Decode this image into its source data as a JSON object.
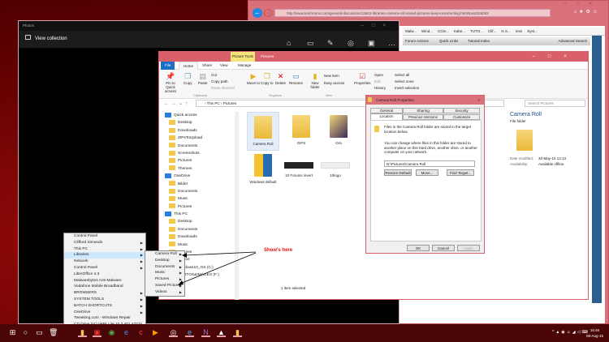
{
  "browser": {
    "url": "http://www.tenforums.com/general-discussion/13943-libraries-camera-roll-saved-pictures-keep-resurrecting.html#post326092",
    "bookmarks": [
      "Malw...",
      "Wind...",
      "CCle...",
      "Kabe...",
      "TUTO...",
      "Clif...",
      "Is S...",
      "msn",
      "Syst..."
    ],
    "forum_bar": {
      "forum_actions": "Forum Actions",
      "quick_links": "Quick Links",
      "tutorial_index": "Tutorial Index",
      "advanced_search": "Advanced Search"
    }
  },
  "photos": {
    "app_title": "Photos",
    "view_collection": "View collection"
  },
  "explorer": {
    "ribbon_context": "Picture Tools",
    "title": "Pictures",
    "tabs": [
      "File",
      "Home",
      "Share",
      "View",
      "Manage"
    ],
    "clipboard": {
      "pin": "Pin to Quick access",
      "copy": "Copy",
      "paste": "Paste",
      "cut": "Cut",
      "copy_path": "Copy path",
      "paste_shortcut": "Paste shortcut",
      "group": "Clipboard"
    },
    "organize": {
      "move_to": "Move to",
      "copy_to": "Copy to",
      "delete": "Delete",
      "rename": "Rename",
      "group": "Organize"
    },
    "new": {
      "new_folder": "New folder",
      "new_item": "New item",
      "easy_access": "Easy access",
      "group": "New"
    },
    "open": {
      "properties": "Properties",
      "open": "Open",
      "edit": "Edit",
      "history": "History",
      "group": "Open"
    },
    "select": {
      "select_all": "Select all",
      "select_none": "Select none",
      "invert": "Invert selection",
      "group": "Select"
    },
    "breadcrumb": [
      "This PC",
      "Pictures"
    ],
    "search_placeholder": "Search Pictures",
    "nav": [
      {
        "label": "Quick access",
        "top": true
      },
      {
        "label": "Desktop"
      },
      {
        "label": "Downloads"
      },
      {
        "label": "ZIPsToUpload"
      },
      {
        "label": "Documents"
      },
      {
        "label": "Screenshots"
      },
      {
        "label": "Pictures"
      },
      {
        "label": "Themes"
      },
      {
        "label": "OneDrive",
        "top": true
      },
      {
        "label": "Bilder"
      },
      {
        "label": "Documents"
      },
      {
        "label": "Music"
      },
      {
        "label": "Pictures"
      },
      {
        "label": "This PC",
        "top": true
      },
      {
        "label": "Desktop"
      },
      {
        "label": "Documents"
      },
      {
        "label": "Downloads"
      },
      {
        "label": "Music"
      },
      {
        "label": "Pictures"
      },
      {
        "label": "Videos"
      },
      {
        "label": "Windows10_OS (C:)"
      },
      {
        "label": "PHOTOS&IMAGES (F:)"
      }
    ],
    "items": [
      "Camera Roll",
      "GIFS",
      "Ora",
      "Windows default",
      "10 Forums invert",
      "10logo"
    ],
    "status": "1 item selected",
    "details": {
      "name": "Camera Roll",
      "type": "File folder",
      "date_label": "Date modified:",
      "date": "30-May-15 13:13",
      "avail_label": "Availability:",
      "avail": "Available offline"
    },
    "partial_item": "...per"
  },
  "dialog": {
    "title": "Camera Roll Properties",
    "tabs_row1": [
      "General",
      "Sharing",
      "Security"
    ],
    "tabs_row2": [
      "Location",
      "Previous Versions",
      "Customize"
    ],
    "text1": "Files in the Camera Roll folder are stored in the target location below.",
    "text2": "You can change where files in this folder are stored to another place on this hard drive, another drive, or another computer on your network.",
    "path": "D:\\Pictures\\Camera Roll",
    "restore": "Restore Default",
    "move": "Move...",
    "find": "Find Target...",
    "ok": "OK",
    "cancel": "Cancel",
    "apply": "Apply"
  },
  "menu": {
    "items": [
      {
        "label": "Control Panel",
        "sub": false
      },
      {
        "label": "Clifford Simonds",
        "sub": true
      },
      {
        "label": "This PC",
        "sub": true
      },
      {
        "label": "Libraries",
        "sub": true
      },
      {
        "label": "Network",
        "sub": true
      },
      {
        "label": "Control Panel",
        "sub": true
      },
      {
        "label": "LibreOffice 4.3",
        "sub": false
      },
      {
        "label": "Malwarebytes Anti-Malware",
        "sub": false
      },
      {
        "label": "Vodafone Mobile Broadband",
        "sub": false
      },
      {
        "label": "BROWSERS",
        "sub": true
      },
      {
        "label": "SYSTEM TOOLS",
        "sub": true
      },
      {
        "label": "BATCH SHORTCUTS",
        "sub": true
      },
      {
        "label": "OneDrive",
        "sub": true
      },
      {
        "label": "Tweaking.com - Windows Repair",
        "sub": false
      },
      {
        "label": "CD Drive (H:) VMB Lite 10.3.401.43721",
        "sub": true
      }
    ],
    "submenu": [
      "Camera Roll",
      "Desktop",
      "Documents",
      "Music",
      "Pictures",
      "Saved Pictures",
      "Videos"
    ]
  },
  "annotation": "Show's here",
  "taskbar": {
    "time": "16:46",
    "date": "08-Aug-15"
  },
  "colors": {
    "accent": "#d9606a",
    "desktop": "#6a0000",
    "annotation": "#e01010"
  }
}
